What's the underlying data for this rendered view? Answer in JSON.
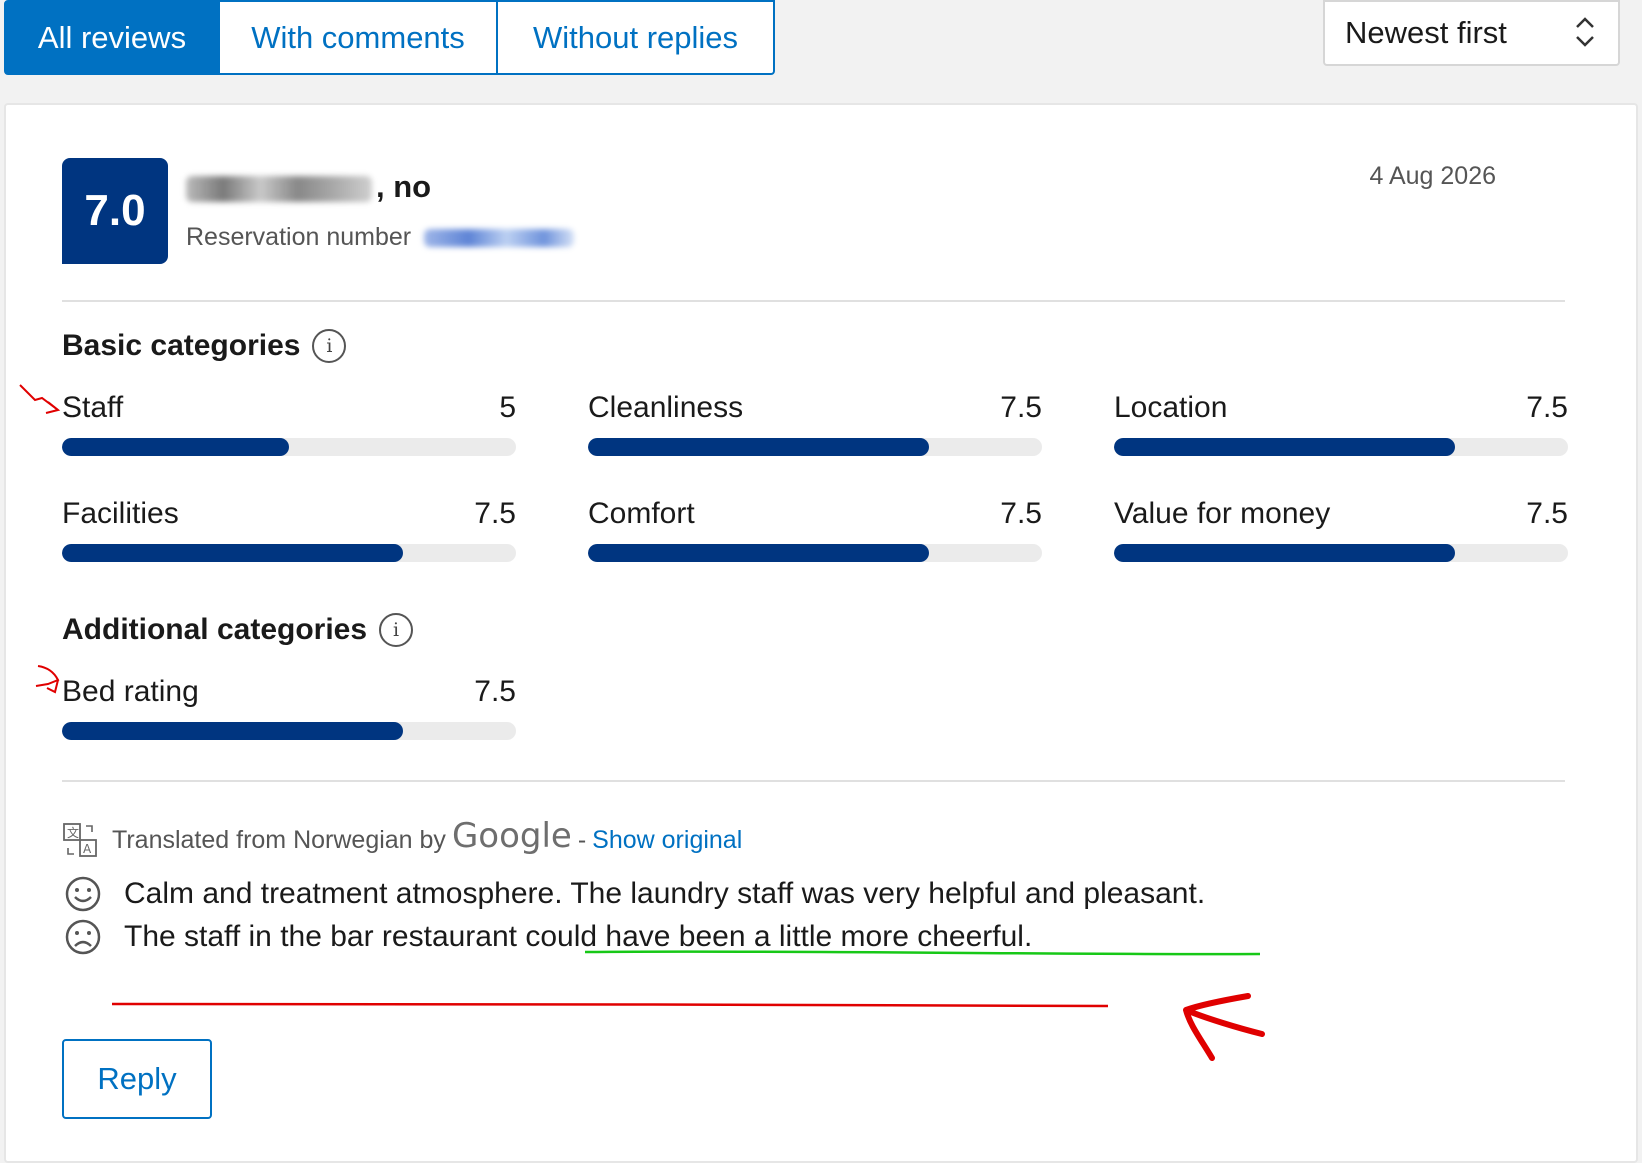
{
  "tabs": [
    {
      "label": "All reviews",
      "active": true
    },
    {
      "label": "With comments",
      "active": false
    },
    {
      "label": "Without replies",
      "active": false
    }
  ],
  "sort": {
    "selected": "Newest first"
  },
  "review": {
    "score": "7.0",
    "guest_suffix": ", no",
    "reservation_label": "Reservation number",
    "date": "4 Aug 2026"
  },
  "basic_categories": {
    "title": "Basic categories",
    "items": [
      {
        "label": "Staff",
        "score": "5",
        "fill": 0.5
      },
      {
        "label": "Cleanliness",
        "score": "7.5",
        "fill": 0.75
      },
      {
        "label": "Location",
        "score": "7.5",
        "fill": 0.75
      },
      {
        "label": "Facilities",
        "score": "7.5",
        "fill": 0.75
      },
      {
        "label": "Comfort",
        "score": "7.5",
        "fill": 0.75
      },
      {
        "label": "Value for money",
        "score": "7.5",
        "fill": 0.75
      }
    ]
  },
  "additional_categories": {
    "title": "Additional categories",
    "items": [
      {
        "label": "Bed rating",
        "score": "7.5",
        "fill": 0.75
      }
    ]
  },
  "translation": {
    "prefix": "Translated from Norwegian by",
    "provider": "Google",
    "separator": "-",
    "link": "Show original"
  },
  "comments": {
    "positive": "Calm and treatment atmosphere. The laundry staff was very helpful and pleasant.",
    "negative": "The staff in the bar restaurant could have been a little more cheerful."
  },
  "reply_label": "Reply",
  "icons": {
    "info": "info-icon",
    "translate": "translate-icon",
    "happy": "smiley-happy-icon",
    "sad": "smiley-sad-icon",
    "sort_chevron": "chevron-up-down-icon"
  },
  "colors": {
    "brand_blue": "#0071c2",
    "score_navy": "#003580",
    "annotation_red": "#e00000",
    "annotation_green": "#17c817"
  }
}
